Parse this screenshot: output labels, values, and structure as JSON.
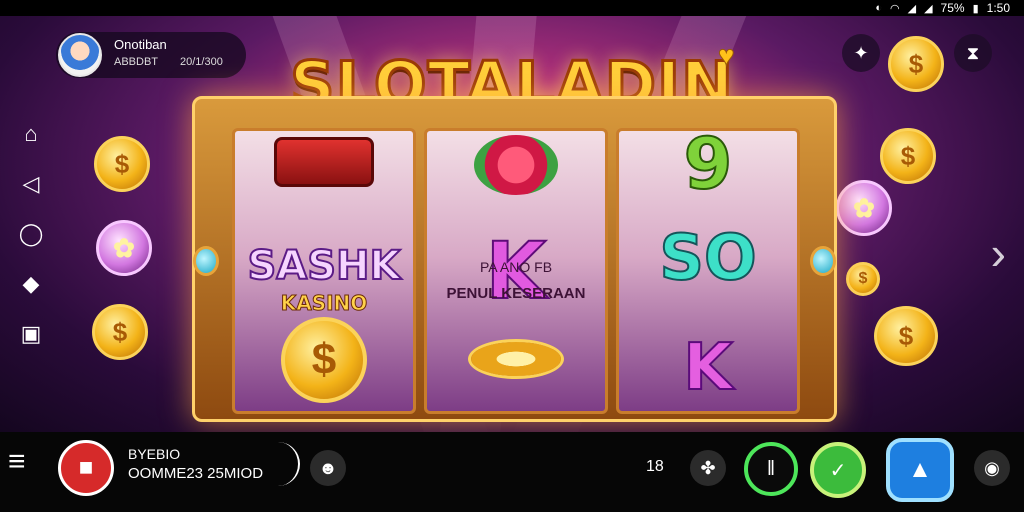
{
  "status": {
    "battery": "75%",
    "time": "1:50",
    "icons": [
      "do-not-disturb-icon",
      "wifi-icon",
      "signal-icon",
      "signal-icon",
      "battery-icon"
    ]
  },
  "profile": {
    "name": "Onotiban",
    "sub_left": "ABBDBT",
    "sub_right": "20/1/300"
  },
  "logo": "SLOTALADIN",
  "reels": {
    "left": {
      "label_big": "SASHK",
      "label_small": "KASINO"
    },
    "middle": {
      "label_big": "K",
      "line1": "PA  ANO  FB",
      "line2": "PENUL KESERAAN"
    },
    "right": {
      "label_big": "SO",
      "label_bottom": "K",
      "label_top": "9"
    }
  },
  "bottom": {
    "line1": "BYEBIO",
    "line2": "OOMME23 25MIOD",
    "counter": "18"
  },
  "colors": {
    "accent_gold": "#ffcf3a",
    "red": "#d62a2a",
    "green": "#3cbb3c",
    "blue": "#1e7fe0"
  }
}
